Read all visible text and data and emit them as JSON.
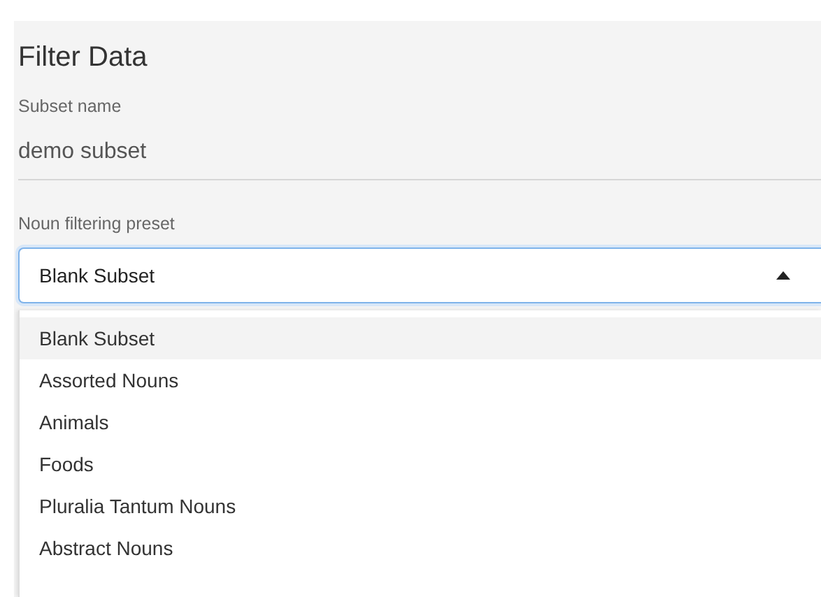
{
  "title": "Filter Data",
  "subset_name": {
    "label": "Subset name",
    "value": "demo subset"
  },
  "preset": {
    "label": "Noun filtering preset",
    "value": "Blank Subset",
    "expanded": true,
    "options": [
      {
        "label": "Blank Subset",
        "selected": true
      },
      {
        "label": "Assorted Nouns",
        "selected": false
      },
      {
        "label": "Animals",
        "selected": false
      },
      {
        "label": "Foods",
        "selected": false
      },
      {
        "label": "Pluralia Tantum Nouns",
        "selected": false
      },
      {
        "label": "Abstract Nouns",
        "selected": false
      }
    ]
  }
}
